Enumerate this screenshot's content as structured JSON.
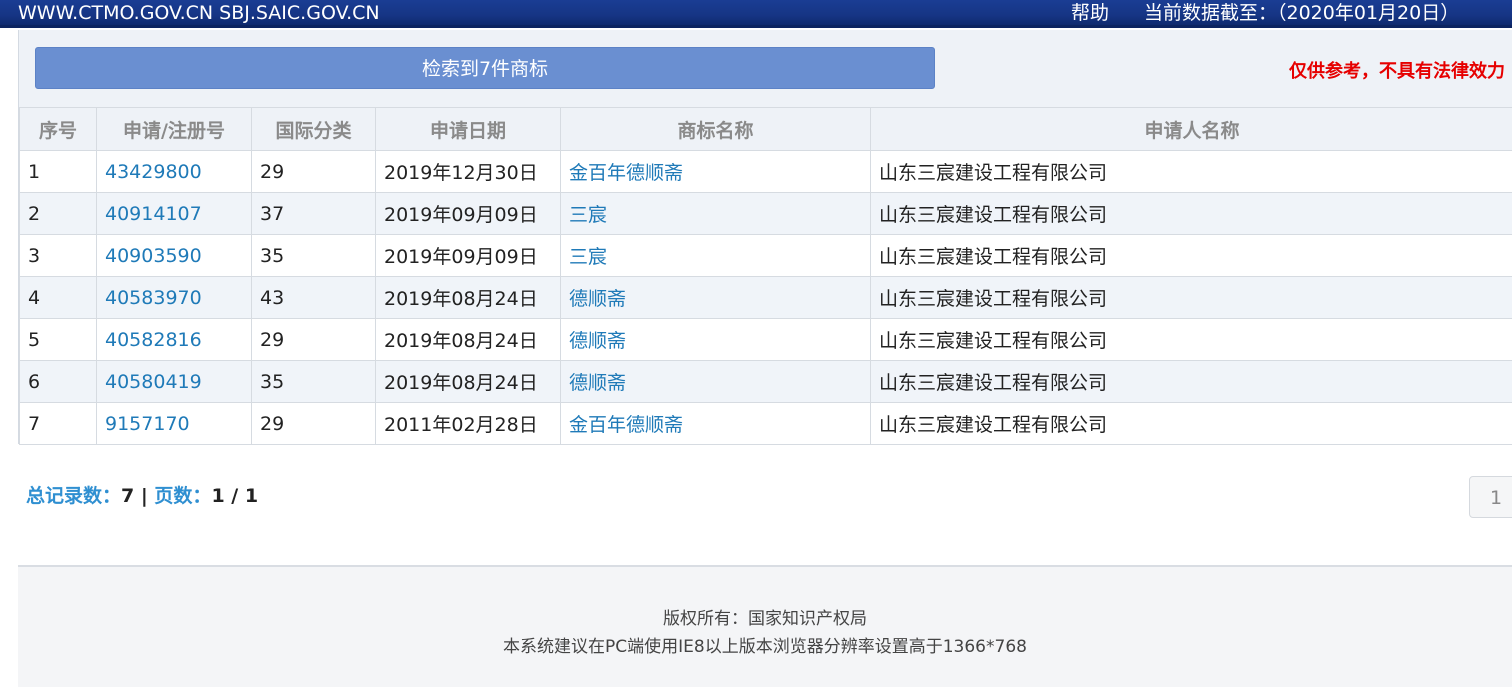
{
  "header": {
    "site_text": "WWW.CTMO.GOV.CN SBJ.SAIC.GOV.CN",
    "help_label": "帮助",
    "data_cutoff": "当前数据截至：（2020年01月20日）"
  },
  "result_bar": {
    "label": "检索到7件商标"
  },
  "disclaimer": "仅供参考，不具有法律效力",
  "table": {
    "columns": [
      "序号",
      "申请/注册号",
      "国际分类",
      "申请日期",
      "商标名称",
      "申请人名称"
    ],
    "rows": [
      {
        "index": "1",
        "reg_no": "43429800",
        "class": "29",
        "date": "2019年12月30日",
        "name": "金百年德顺斋",
        "applicant": "山东三宸建设工程有限公司"
      },
      {
        "index": "2",
        "reg_no": "40914107",
        "class": "37",
        "date": "2019年09月09日",
        "name": "三宸",
        "applicant": "山东三宸建设工程有限公司"
      },
      {
        "index": "3",
        "reg_no": "40903590",
        "class": "35",
        "date": "2019年09月09日",
        "name": "三宸",
        "applicant": "山东三宸建设工程有限公司"
      },
      {
        "index": "4",
        "reg_no": "40583970",
        "class": "43",
        "date": "2019年08月24日",
        "name": "德顺斋",
        "applicant": "山东三宸建设工程有限公司"
      },
      {
        "index": "5",
        "reg_no": "40582816",
        "class": "29",
        "date": "2019年08月24日",
        "name": "德顺斋",
        "applicant": "山东三宸建设工程有限公司"
      },
      {
        "index": "6",
        "reg_no": "40580419",
        "class": "35",
        "date": "2019年08月24日",
        "name": "德顺斋",
        "applicant": "山东三宸建设工程有限公司"
      },
      {
        "index": "7",
        "reg_no": "9157170",
        "class": "29",
        "date": "2011年02月28日",
        "name": "金百年德顺斋",
        "applicant": "山东三宸建设工程有限公司"
      }
    ]
  },
  "summary": {
    "total_label": "总记录数：",
    "total_value": "7",
    "separator": " | ",
    "pages_label": "页数：",
    "pages_value": "1 / 1"
  },
  "pager": {
    "current_page": "1"
  },
  "footer": {
    "copyright": "版权所有：国家知识产权局",
    "recommendation": "本系统建议在PC端使用IE8以上版本浏览器分辨率设置高于1366*768"
  },
  "colors": {
    "header_bg": "#163585",
    "result_bar_bg": "#6a8fd1",
    "disclaimer": "#e60000",
    "link": "#1f7ab8",
    "summary_label": "#2f8fd1"
  }
}
